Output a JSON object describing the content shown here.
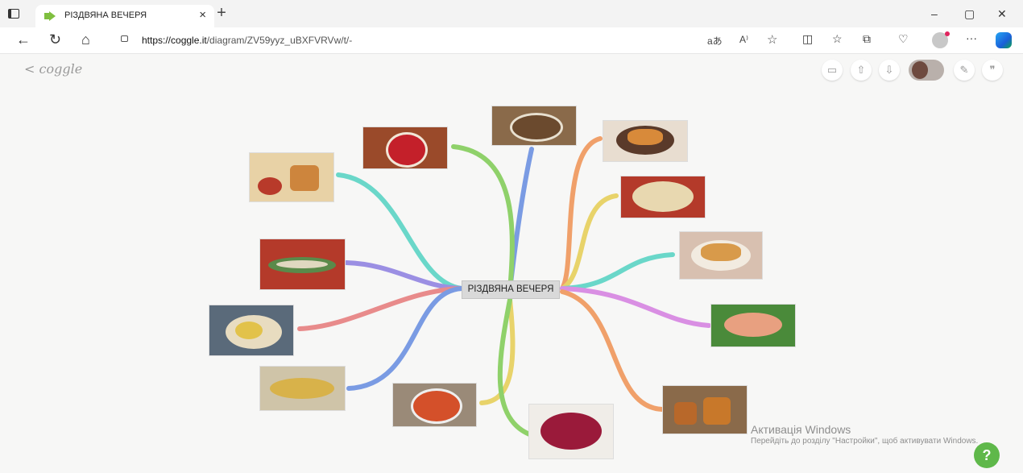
{
  "browser": {
    "tab_title": "РІЗДВЯНА ВЕЧЕРЯ",
    "tab_close": "×",
    "new_tab": "+",
    "url_host": "https://coggle.it",
    "url_path": "/diagram/ZV59yyz_uBXFVRVw/t/-",
    "window_controls": {
      "minimize": "–",
      "restore": "▢",
      "close": "✕"
    },
    "nav": {
      "back": "←",
      "reload": "↻",
      "home": "⌂"
    },
    "toolbar_icons": [
      "read-aloud-icon",
      "immersive-reader-icon",
      "favorite-star-icon",
      "split-screen-icon",
      "favorites-icon",
      "collections-icon",
      "browser-essentials-icon",
      "profile-icon",
      "more-icon",
      "copilot-icon"
    ],
    "more": "···"
  },
  "coggle": {
    "brand": "coggle",
    "back": "<",
    "controls": [
      "present-icon",
      "share-icon",
      "download-icon",
      "collaborators-icon",
      "edit-icon",
      "comments-icon"
    ]
  },
  "mindmap": {
    "central_label": "РІЗДВЯНА ВЕЧЕРЯ",
    "branches": [
      {
        "name": "buckwheat-kutia-image",
        "color": "#7a9be3"
      },
      {
        "name": "borscht-image",
        "color": "#8fd16a"
      },
      {
        "name": "uzvar-drink-image",
        "color": "#6ad7c9"
      },
      {
        "name": "herring-image",
        "color": "#9b8fe3"
      },
      {
        "name": "boiled-potatoes-image",
        "color": "#e88b8b"
      },
      {
        "name": "cabbage-rolls-image",
        "color": "#7a9be3"
      },
      {
        "name": "carrot-salad-image",
        "color": "#e8d36a"
      },
      {
        "name": "vinaigrette-image",
        "color": "#8fd16a"
      },
      {
        "name": "fried-pies-image",
        "color": "#f0a06a"
      },
      {
        "name": "baked-buns-image",
        "color": "#e8d36a"
      },
      {
        "name": "pyrizhky-image",
        "color": "#6ad7c9"
      },
      {
        "name": "fish-aspic-image",
        "color": "#d98fe3"
      },
      {
        "name": "uzvar-cups-image",
        "color": "#f0a06a"
      }
    ]
  },
  "windows_activation": {
    "title": "Активація Windows",
    "subtitle": "Перейдіть до розділу \"Настройки\", щоб активувати Windows."
  },
  "help": {
    "label": "?"
  }
}
